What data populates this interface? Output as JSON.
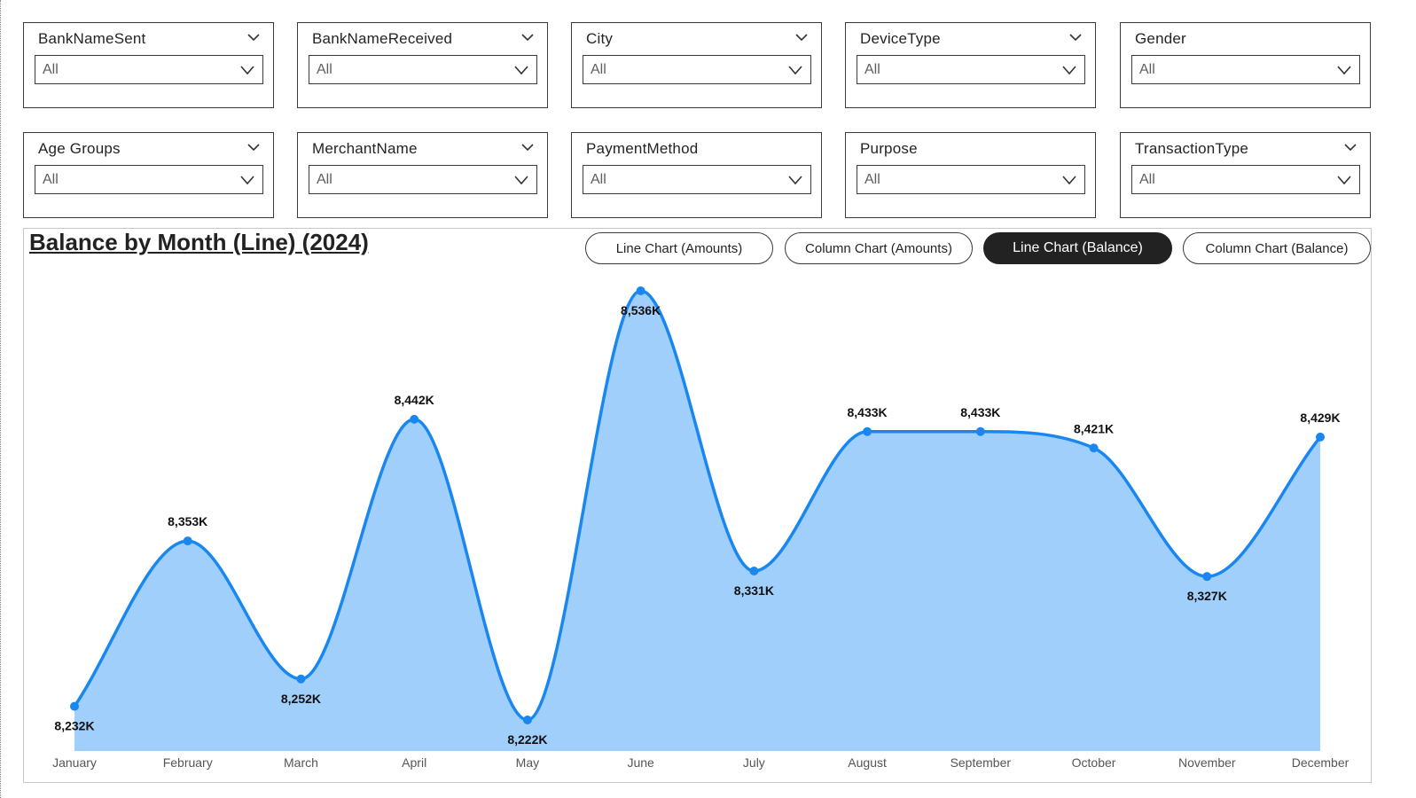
{
  "slicers": [
    {
      "title": "BankNameSent",
      "value": "All",
      "has_header_chevron": true
    },
    {
      "title": "BankNameReceived",
      "value": "All",
      "has_header_chevron": true
    },
    {
      "title": "City",
      "value": "All",
      "has_header_chevron": true
    },
    {
      "title": "DeviceType",
      "value": "All",
      "has_header_chevron": true
    },
    {
      "title": "Gender",
      "value": "All",
      "has_header_chevron": false
    },
    {
      "title": "Age Groups",
      "value": "All",
      "has_header_chevron": true
    },
    {
      "title": "MerchantName",
      "value": "All",
      "has_header_chevron": true
    },
    {
      "title": "PaymentMethod",
      "value": "All",
      "has_header_chevron": false
    },
    {
      "title": "Purpose",
      "value": "All",
      "has_header_chevron": false
    },
    {
      "title": "TransactionType",
      "value": "All",
      "has_header_chevron": true
    }
  ],
  "chart_panel": {
    "title": "Balance by Month (Line) (2024)",
    "buttons": [
      {
        "label": "Line Chart (Amounts)",
        "active": false
      },
      {
        "label": "Column Chart (Amounts)",
        "active": false
      },
      {
        "label": "Line Chart (Balance)",
        "active": true
      },
      {
        "label": "Column Chart (Balance)",
        "active": false
      }
    ]
  },
  "colors": {
    "line": "#1a87f0",
    "area": "#a0cffb",
    "active_button": "#222222"
  },
  "chart_data": {
    "type": "area",
    "title": "Balance by Month (Line) (2024)",
    "categories": [
      "January",
      "February",
      "March",
      "April",
      "May",
      "June",
      "July",
      "August",
      "September",
      "October",
      "November",
      "December"
    ],
    "values": [
      8232,
      8353,
      8252,
      8442,
      8222,
      8536,
      8331,
      8433,
      8433,
      8421,
      8327,
      8429
    ],
    "data_labels": [
      "8,232K",
      "8,353K",
      "8,252K",
      "8,442K",
      "8,222K",
      "8,536K",
      "8,331K",
      "8,433K",
      "8,433K",
      "8,421K",
      "8,327K",
      "8,429K"
    ],
    "units": "K",
    "grid": false,
    "legend": "none",
    "curve": "smooth"
  }
}
